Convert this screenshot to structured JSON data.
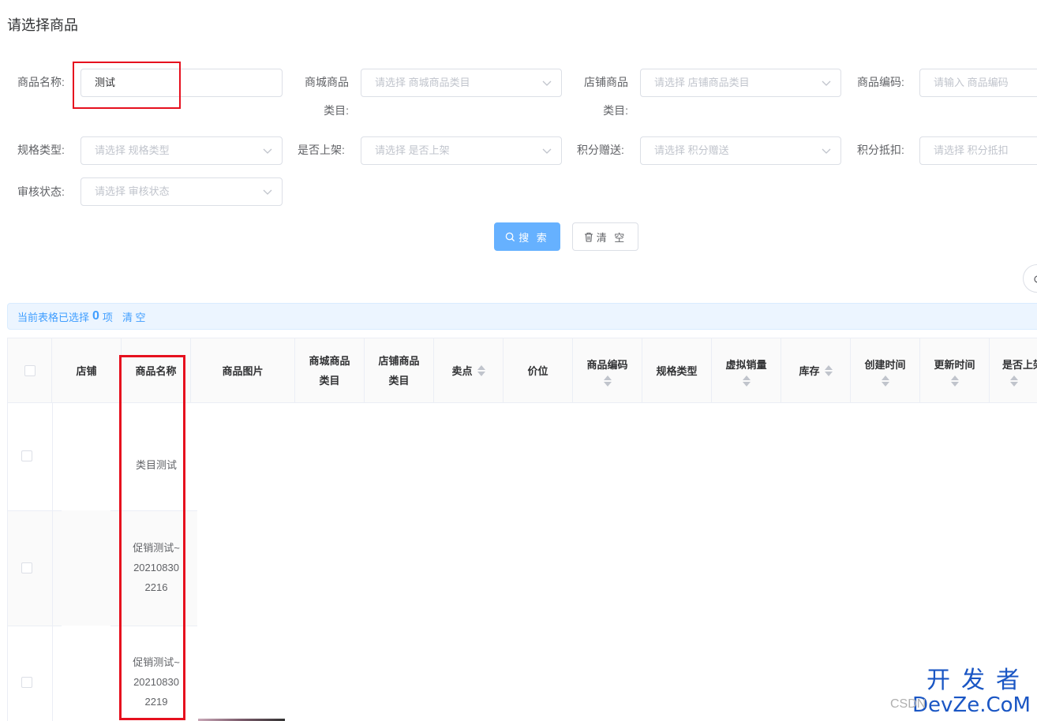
{
  "dialog": {
    "title": "请选择商品"
  },
  "form": {
    "product_name": {
      "label": "商品名称:",
      "value": "测试"
    },
    "mall_category": {
      "label_line1": "商城商品",
      "label_line2": "类目:",
      "placeholder": "请选择 商城商品类目"
    },
    "shop_category": {
      "label_line1": "店铺商品",
      "label_line2": "类目:",
      "placeholder": "请选择 店铺商品类目"
    },
    "product_code": {
      "label": "商品编码:",
      "placeholder": "请输入 商品编码"
    },
    "spec_type": {
      "label": "规格类型:",
      "placeholder": "请选择 规格类型"
    },
    "on_shelf": {
      "label": "是否上架:",
      "placeholder": "请选择 是否上架"
    },
    "points_gift": {
      "label": "积分赠送:",
      "placeholder": "请选择 积分赠送"
    },
    "points_deduct": {
      "label": "积分抵扣:",
      "placeholder": "请选择 积分抵扣"
    },
    "audit_status": {
      "label": "审核状态:",
      "placeholder": "请选择 审核状态"
    }
  },
  "actions": {
    "search_label": "搜 索",
    "clear_label": "清 空"
  },
  "selection": {
    "prefix": "当前表格已选择",
    "count": "0",
    "suffix": "项",
    "clear_label": "清 空"
  },
  "table": {
    "headers": {
      "shop": "店铺",
      "product_name": "商品名称",
      "product_image": "商品图片",
      "mall_category_1": "商城商品",
      "mall_category_2": "类目",
      "shop_category_1": "店铺商品",
      "shop_category_2": "类目",
      "selling_point": "卖点",
      "price": "价位",
      "product_code": "商品编码",
      "spec_type": "规格类型",
      "virtual_sales": "虚拟销量",
      "stock": "库存",
      "created_at": "创建时间",
      "updated_at": "更新时间",
      "on_shelf": "是否上架"
    },
    "rows": [
      {
        "name_lines": [
          "类目测试"
        ]
      },
      {
        "name_lines": [
          "促销测试~",
          "20210830",
          "2216"
        ]
      },
      {
        "name_lines": [
          "促销测试~",
          "20210830",
          "2219"
        ]
      }
    ]
  },
  "watermark": {
    "top": "开发者",
    "bottom": "DevZe.CoM",
    "csdn": "CSDN"
  },
  "colors": {
    "primary": "#409eff",
    "primary_light": "#66b1ff",
    "highlight_red": "#e6101e"
  },
  "icons": {
    "search": "search-icon",
    "delete": "trash-icon",
    "dropdown": "chevron-down-icon",
    "refresh": "refresh-icon"
  }
}
